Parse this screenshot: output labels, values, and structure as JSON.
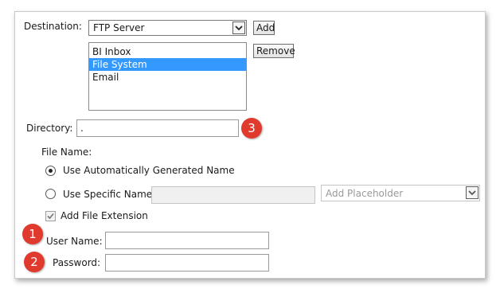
{
  "destination": {
    "label": "Destination:",
    "selected": "FTP Server",
    "add_label": "Add",
    "remove_label": "Remove",
    "list_items": [
      {
        "label": "BI Inbox",
        "selected": false
      },
      {
        "label": "File System",
        "selected": true
      },
      {
        "label": "Email",
        "selected": false
      }
    ]
  },
  "directory": {
    "label": "Directory:",
    "value": ".",
    "callout": "3"
  },
  "file_name": {
    "heading": "File Name:",
    "auto_label": "Use Automatically Generated Name",
    "auto_checked": true,
    "specific_label": "Use Specific Name",
    "specific_checked": false,
    "specific_value": "",
    "placeholder_select": "Add Placeholder",
    "extension_label": "Add File Extension",
    "extension_checked": true
  },
  "credentials": {
    "username_label": "User Name:",
    "username_value": "",
    "username_callout": "1",
    "password_label": "Password:",
    "password_value": "",
    "password_callout": "2"
  },
  "colors": {
    "selection": "#3399ff",
    "callout": "#e03a2e"
  }
}
